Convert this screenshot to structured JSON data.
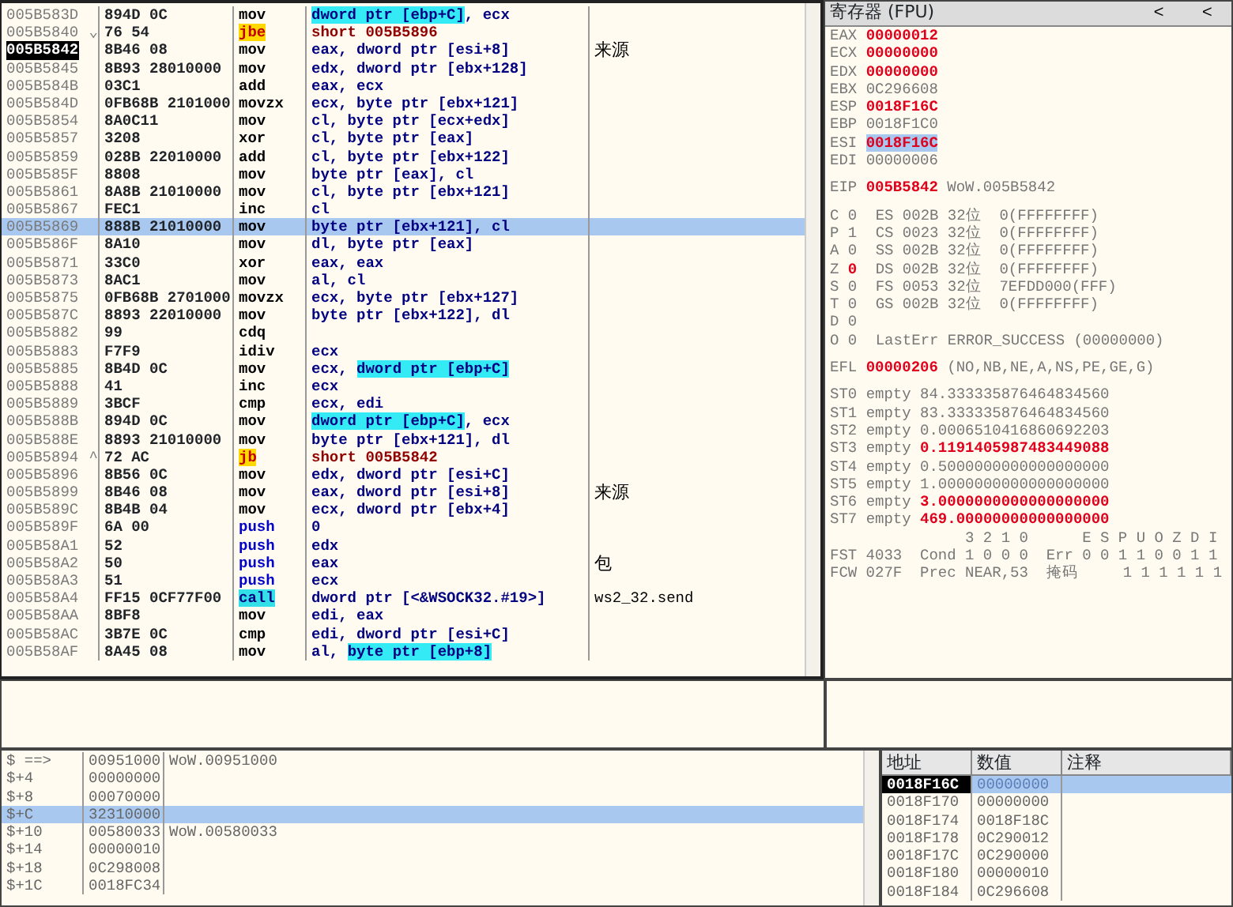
{
  "disassembly": {
    "rows": [
      {
        "address": "005B583D",
        "bytes": "894D 0C",
        "mnemonic": "mov",
        "kind": "plain",
        "operands": [
          {
            "text": "dword ptr [ebp+C]",
            "highlighted": true
          },
          {
            "text": ", ecx",
            "highlighted": false
          }
        ],
        "current": false,
        "selected": false
      },
      {
        "address": "005B5840",
        "branch_mark": "⌄",
        "bytes": "76 54",
        "mnemonic": "jbe",
        "kind": "jump",
        "operands": [
          {
            "text": "short 005B5896",
            "highlighted": false
          }
        ],
        "current": false,
        "selected": false
      },
      {
        "address": "005B5842",
        "bytes": "8B46 08",
        "mnemonic": "mov",
        "kind": "plain",
        "operands": [
          {
            "text": "eax, dword ptr [esi+8]",
            "highlighted": false
          }
        ],
        "comment": "来源",
        "current": true,
        "selected": false
      },
      {
        "address": "005B5845",
        "bytes": "8B93 28010000",
        "mnemonic": "mov",
        "kind": "plain",
        "operands": [
          {
            "text": "edx, dword ptr [ebx+128]",
            "highlighted": false
          }
        ],
        "current": false,
        "selected": false
      },
      {
        "address": "005B584B",
        "bytes": "03C1",
        "mnemonic": "add",
        "kind": "plain",
        "operands": [
          {
            "text": "eax, ecx",
            "highlighted": false
          }
        ],
        "current": false,
        "selected": false
      },
      {
        "address": "005B584D",
        "bytes": "0FB68B 2101000",
        "mnemonic": "movzx",
        "kind": "plain",
        "operands": [
          {
            "text": "ecx, byte ptr [ebx+121]",
            "highlighted": false
          }
        ],
        "current": false,
        "selected": false
      },
      {
        "address": "005B5854",
        "bytes": "8A0C11",
        "mnemonic": "mov",
        "kind": "plain",
        "operands": [
          {
            "text": "cl, byte ptr [ecx+edx]",
            "highlighted": false
          }
        ],
        "current": false,
        "selected": false
      },
      {
        "address": "005B5857",
        "bytes": "3208",
        "mnemonic": "xor",
        "kind": "plain",
        "operands": [
          {
            "text": "cl, byte ptr [eax]",
            "highlighted": false
          }
        ],
        "current": false,
        "selected": false
      },
      {
        "address": "005B5859",
        "bytes": "028B 22010000",
        "mnemonic": "add",
        "kind": "plain",
        "operands": [
          {
            "text": "cl, byte ptr [ebx+122]",
            "highlighted": false
          }
        ],
        "current": false,
        "selected": false
      },
      {
        "address": "005B585F",
        "bytes": "8808",
        "mnemonic": "mov",
        "kind": "plain",
        "operands": [
          {
            "text": "byte ptr [eax], cl",
            "highlighted": false
          }
        ],
        "current": false,
        "selected": false
      },
      {
        "address": "005B5861",
        "bytes": "8A8B 21010000",
        "mnemonic": "mov",
        "kind": "plain",
        "operands": [
          {
            "text": "cl, byte ptr [ebx+121]",
            "highlighted": false
          }
        ],
        "current": false,
        "selected": false
      },
      {
        "address": "005B5867",
        "bytes": "FEC1",
        "mnemonic": "inc",
        "kind": "plain",
        "operands": [
          {
            "text": "cl",
            "highlighted": false
          }
        ],
        "current": false,
        "selected": false
      },
      {
        "address": "005B5869",
        "bytes": "888B 21010000",
        "mnemonic": "mov",
        "kind": "plain",
        "operands": [
          {
            "text": "byte ptr [ebx+121], cl",
            "highlighted": false
          }
        ],
        "current": false,
        "selected": true
      },
      {
        "address": "005B586F",
        "bytes": "8A10",
        "mnemonic": "mov",
        "kind": "plain",
        "operands": [
          {
            "text": "dl, byte ptr [eax]",
            "highlighted": false
          }
        ],
        "current": false,
        "selected": false
      },
      {
        "address": "005B5871",
        "bytes": "33C0",
        "mnemonic": "xor",
        "kind": "plain",
        "operands": [
          {
            "text": "eax, eax",
            "highlighted": false
          }
        ],
        "current": false,
        "selected": false
      },
      {
        "address": "005B5873",
        "bytes": "8AC1",
        "mnemonic": "mov",
        "kind": "plain",
        "operands": [
          {
            "text": "al, cl",
            "highlighted": false
          }
        ],
        "current": false,
        "selected": false
      },
      {
        "address": "005B5875",
        "bytes": "0FB68B 2701000",
        "mnemonic": "movzx",
        "kind": "plain",
        "operands": [
          {
            "text": "ecx, byte ptr [ebx+127]",
            "highlighted": false
          }
        ],
        "current": false,
        "selected": false
      },
      {
        "address": "005B587C",
        "bytes": "8893 22010000",
        "mnemonic": "mov",
        "kind": "plain",
        "operands": [
          {
            "text": "byte ptr [ebx+122], dl",
            "highlighted": false
          }
        ],
        "current": false,
        "selected": false
      },
      {
        "address": "005B5882",
        "bytes": "99",
        "mnemonic": "cdq",
        "kind": "plain",
        "operands": [],
        "current": false,
        "selected": false
      },
      {
        "address": "005B5883",
        "bytes": "F7F9",
        "mnemonic": "idiv",
        "kind": "plain",
        "operands": [
          {
            "text": "ecx",
            "highlighted": false
          }
        ],
        "current": false,
        "selected": false
      },
      {
        "address": "005B5885",
        "bytes": "8B4D 0C",
        "mnemonic": "mov",
        "kind": "plain",
        "operands": [
          {
            "text": "ecx, ",
            "highlighted": false
          },
          {
            "text": "dword ptr [ebp+C]",
            "highlighted": true
          }
        ],
        "current": false,
        "selected": false
      },
      {
        "address": "005B5888",
        "bytes": "41",
        "mnemonic": "inc",
        "kind": "plain",
        "operands": [
          {
            "text": "ecx",
            "highlighted": false
          }
        ],
        "current": false,
        "selected": false
      },
      {
        "address": "005B5889",
        "bytes": "3BCF",
        "mnemonic": "cmp",
        "kind": "plain",
        "operands": [
          {
            "text": "ecx, edi",
            "highlighted": false
          }
        ],
        "current": false,
        "selected": false
      },
      {
        "address": "005B588B",
        "bytes": "894D 0C",
        "mnemonic": "mov",
        "kind": "plain",
        "operands": [
          {
            "text": "dword ptr [ebp+C]",
            "highlighted": true
          },
          {
            "text": ", ecx",
            "highlighted": false
          }
        ],
        "current": false,
        "selected": false
      },
      {
        "address": "005B588E",
        "bytes": "8893 21010000",
        "mnemonic": "mov",
        "kind": "plain",
        "operands": [
          {
            "text": "byte ptr [ebx+121], dl",
            "highlighted": false
          }
        ],
        "current": false,
        "selected": false
      },
      {
        "address": "005B5894",
        "branch_mark": "^",
        "bytes": "72 AC",
        "mnemonic": "jb",
        "kind": "jump",
        "operands": [
          {
            "text": "short 005B5842",
            "highlighted": false
          }
        ],
        "current": false,
        "selected": false
      },
      {
        "address": "005B5896",
        "bytes": "8B56 0C",
        "mnemonic": "mov",
        "kind": "plain",
        "operands": [
          {
            "text": "edx, dword ptr [esi+C]",
            "highlighted": false
          }
        ],
        "current": false,
        "selected": false
      },
      {
        "address": "005B5899",
        "bytes": "8B46 08",
        "mnemonic": "mov",
        "kind": "plain",
        "operands": [
          {
            "text": "eax, dword ptr [esi+8]",
            "highlighted": false
          }
        ],
        "comment": "来源",
        "current": false,
        "selected": false
      },
      {
        "address": "005B589C",
        "bytes": "8B4B 04",
        "mnemonic": "mov",
        "kind": "plain",
        "operands": [
          {
            "text": "ecx, dword ptr [ebx+4]",
            "highlighted": false
          }
        ],
        "current": false,
        "selected": false
      },
      {
        "address": "005B589F",
        "bytes": "6A 00",
        "mnemonic": "push",
        "kind": "push",
        "operands": [
          {
            "text": "0",
            "highlighted": false
          }
        ],
        "current": false,
        "selected": false
      },
      {
        "address": "005B58A1",
        "bytes": "52",
        "mnemonic": "push",
        "kind": "push",
        "operands": [
          {
            "text": "edx",
            "highlighted": false
          }
        ],
        "current": false,
        "selected": false
      },
      {
        "address": "005B58A2",
        "bytes": "50",
        "mnemonic": "push",
        "kind": "push",
        "operands": [
          {
            "text": "eax",
            "highlighted": false
          }
        ],
        "comment": "包",
        "current": false,
        "selected": false
      },
      {
        "address": "005B58A3",
        "bytes": "51",
        "mnemonic": "push",
        "kind": "push",
        "operands": [
          {
            "text": "ecx",
            "highlighted": false
          }
        ],
        "current": false,
        "selected": false
      },
      {
        "address": "005B58A4",
        "bytes": "FF15 0CF77F00",
        "mnemonic": "call",
        "kind": "call",
        "operands": [
          {
            "text": "dword ptr [<&WSOCK32.#19>]",
            "highlighted": false
          }
        ],
        "comment": "ws2_32.send",
        "current": false,
        "selected": false
      },
      {
        "address": "005B58AA",
        "bytes": "8BF8",
        "mnemonic": "mov",
        "kind": "plain",
        "operands": [
          {
            "text": "edi, eax",
            "highlighted": false
          }
        ],
        "current": false,
        "selected": false
      },
      {
        "address": "005B58AC",
        "bytes": "3B7E 0C",
        "mnemonic": "cmp",
        "kind": "plain",
        "operands": [
          {
            "text": "edi, dword ptr [esi+C]",
            "highlighted": false
          }
        ],
        "current": false,
        "selected": false
      },
      {
        "address": "005B58AF",
        "bytes": "8A45 08",
        "mnemonic": "mov",
        "kind": "plain",
        "operands": [
          {
            "text": "al, ",
            "highlighted": false
          },
          {
            "text": "byte ptr [ebp+8]",
            "highlighted": true
          }
        ],
        "current": false,
        "selected": false
      }
    ]
  },
  "registers": {
    "title": "寄存器 (FPU)",
    "buttons": [
      "<",
      "<"
    ],
    "general": [
      {
        "name": "EAX",
        "value": "00000012",
        "changed": true,
        "selected": false
      },
      {
        "name": "ECX",
        "value": "00000000",
        "changed": true,
        "selected": false
      },
      {
        "name": "EDX",
        "value": "00000000",
        "changed": true,
        "selected": false
      },
      {
        "name": "EBX",
        "value": "0C296608",
        "changed": false,
        "selected": false
      },
      {
        "name": "ESP",
        "value": "0018F16C",
        "changed": true,
        "selected": false
      },
      {
        "name": "EBP",
        "value": "0018F1C0",
        "changed": false,
        "selected": false
      },
      {
        "name": "ESI",
        "value": "0018F16C",
        "changed": true,
        "selected": true
      },
      {
        "name": "EDI",
        "value": "00000006",
        "changed": false,
        "selected": false
      }
    ],
    "eip": {
      "name": "EIP",
      "value": "005B5842",
      "changed": true,
      "comment": "WoW.005B5842"
    },
    "flags": [
      {
        "flag": "C",
        "value": "0",
        "changed": false,
        "detail": "ES 002B 32位  0(FFFFFFFF)"
      },
      {
        "flag": "P",
        "value": "1",
        "changed": false,
        "detail": "CS 0023 32位  0(FFFFFFFF)"
      },
      {
        "flag": "A",
        "value": "0",
        "changed": false,
        "detail": "SS 002B 32位  0(FFFFFFFF)"
      },
      {
        "flag": "Z",
        "value": "0",
        "changed": true,
        "detail": "DS 002B 32位  0(FFFFFFFF)"
      },
      {
        "flag": "S",
        "value": "0",
        "changed": false,
        "detail": "FS 0053 32位  7EFDD000(FFF)"
      },
      {
        "flag": "T",
        "value": "0",
        "changed": false,
        "detail": "GS 002B 32位  0(FFFFFFFF)"
      },
      {
        "flag": "D",
        "value": "0",
        "changed": false
      },
      {
        "flag": "O",
        "value": "0",
        "changed": false,
        "detail": "LastErr ERROR_SUCCESS (00000000)"
      }
    ],
    "efl": {
      "name": "EFL",
      "value": "00000206",
      "changed": true,
      "decoded": "(NO,NB,NE,A,NS,PE,GE,G)"
    },
    "fpu_stack": [
      {
        "name": "ST0",
        "tag": "empty",
        "value": "84.333335876464834560",
        "changed": false
      },
      {
        "name": "ST1",
        "tag": "empty",
        "value": "83.333335876464834560",
        "changed": false
      },
      {
        "name": "ST2",
        "tag": "empty",
        "value": "0.0006510416860692203",
        "changed": false
      },
      {
        "name": "ST3",
        "tag": "empty",
        "value": "0.1191405987483449088",
        "changed": true
      },
      {
        "name": "ST4",
        "tag": "empty",
        "value": "0.5000000000000000000",
        "changed": false
      },
      {
        "name": "ST5",
        "tag": "empty",
        "value": "1.0000000000000000000",
        "changed": false
      },
      {
        "name": "ST6",
        "tag": "empty",
        "value": "3.0000000000000000000",
        "changed": true
      },
      {
        "name": "ST7",
        "tag": "empty",
        "value": "469.00000000000000000",
        "changed": true
      }
    ],
    "fpu_status": [
      "               3 2 1 0      E S P U O Z D I",
      "FST 4033  Cond 1 0 0 0  Err 0 0 1 1 0 0 1 1",
      "FCW 027F  Prec NEAR,53  掩码     1 1 1 1 1 1"
    ]
  },
  "stack": {
    "rows": [
      {
        "offset": "$ ==>",
        "value": "00951000",
        "comment": "WoW.00951000",
        "selected": false
      },
      {
        "offset": "$+4",
        "value": "00000000",
        "selected": false
      },
      {
        "offset": "$+8",
        "value": "00070000",
        "selected": false
      },
      {
        "offset": "$+C",
        "value": "32310000",
        "selected": true
      },
      {
        "offset": "$+10",
        "value": "00580033",
        "comment": "WoW.00580033",
        "selected": false
      },
      {
        "offset": "$+14",
        "value": "00000010",
        "selected": false
      },
      {
        "offset": "$+18",
        "value": "0C298008",
        "selected": false
      },
      {
        "offset": "$+1C",
        "value": "0018FC34",
        "selected": false
      }
    ]
  },
  "dump": {
    "columns": [
      "地址",
      "数值",
      "注释"
    ],
    "rows": [
      {
        "address": "0018F16C",
        "value": "00000000",
        "current": true,
        "selected": true
      },
      {
        "address": "0018F170",
        "value": "00000000",
        "current": false,
        "selected": false
      },
      {
        "address": "0018F174",
        "value": "0018F18C",
        "current": false,
        "selected": false
      },
      {
        "address": "0018F178",
        "value": "0C290012",
        "current": false,
        "selected": false
      },
      {
        "address": "0018F17C",
        "value": "0C290000",
        "current": false,
        "selected": false
      },
      {
        "address": "0018F180",
        "value": "00000010",
        "current": false,
        "selected": false
      },
      {
        "address": "0018F184",
        "value": "0C296608",
        "current": false,
        "selected": false
      }
    ]
  }
}
